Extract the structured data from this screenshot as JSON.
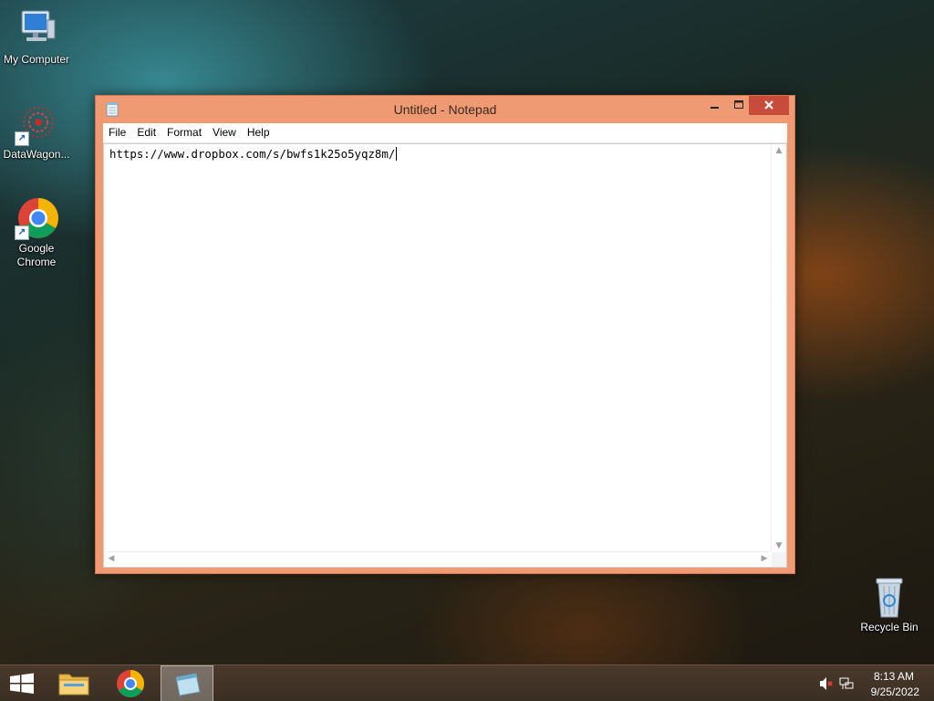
{
  "desktop": {
    "icons": [
      {
        "label": "My Computer",
        "icon": "computer-icon"
      },
      {
        "label": "DataWagon...",
        "icon": "datawagon-icon"
      },
      {
        "label": "Google Chrome",
        "icon": "chrome-icon"
      },
      {
        "label": "Recycle Bin",
        "icon": "recycle-bin-icon"
      }
    ]
  },
  "window": {
    "title": "Untitled - Notepad",
    "menu": [
      "File",
      "Edit",
      "Format",
      "View",
      "Help"
    ],
    "content": "https://www.dropbox.com/s/bwfs1k25o5yqz8m/"
  },
  "taskbar": {
    "time": "8:13 AM",
    "date": "9/25/2022"
  },
  "colors": {
    "window_frame": "#ef9a72",
    "close_button": "#c94b3c",
    "taskbar": "#3a2d22"
  }
}
